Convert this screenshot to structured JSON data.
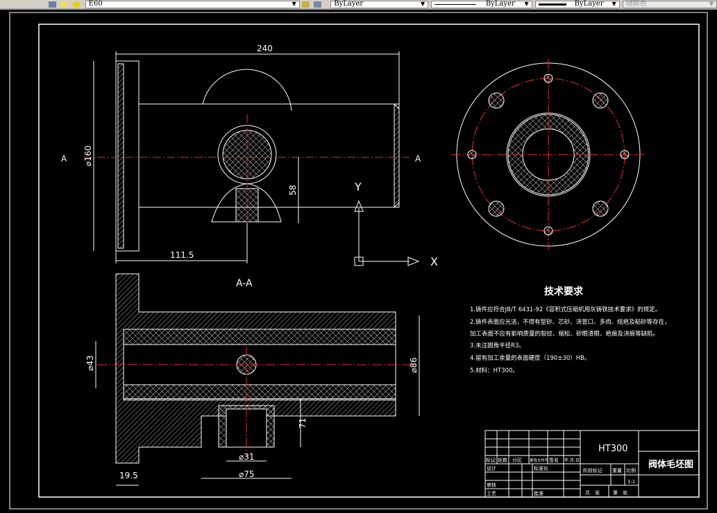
{
  "toolbar": {
    "layer_name": "E60",
    "color": "ByLayer",
    "linetype": "ByLayer",
    "lineweight": "ByLayer",
    "plotstyle": "随颜色"
  },
  "drawing": {
    "dim_240": "240",
    "dim_d160": "⌀160",
    "dim_58": "58",
    "dim_111_5": "111.5",
    "section_mark_left": "A",
    "section_mark_right": "A",
    "section_title": "A-A",
    "dim_d43": "⌀43",
    "dim_d86": "⌀86",
    "dim_71": "71",
    "dim_d31": "⌀31",
    "dim_d75": "⌀75",
    "dim_19_5": "19.5",
    "ucs_x": "X",
    "ucs_y": "Y"
  },
  "tech_requirements": {
    "title": "技术要求",
    "lines": [
      "1.铸件应符合JB/T 6431-92《容积式压缩机用灰铸铁技术要求》的规定。",
      "2.铸件表面应光洁，不得有型砂、芯砂、浇冒口、多肉、结疤及粘砂等存在，",
      "加工表面不应有影响质量的裂纹、缩松、砂眼渣眼、疤痕及浇痕等缺陷。",
      "3.未注圆角半径R3。",
      "4.留有加工余量的表面硬度（190±30）HB。",
      "5.材料：HT300。"
    ]
  },
  "title_block": {
    "material": "HT300",
    "drawing_name": "阀体毛坯图",
    "headers": [
      "标记",
      "处数",
      "分区",
      "更改文件号",
      "签名",
      "年.月.日"
    ],
    "design": "设计",
    "standardization": "标准化",
    "review": "审核",
    "process": "工艺",
    "approve": "批准",
    "stage_mark": "阶段标记",
    "weight": "重量",
    "scale_label": "比例",
    "scale": "1:1",
    "sheets_total": "共　张",
    "sheet_no": "第　张"
  }
}
